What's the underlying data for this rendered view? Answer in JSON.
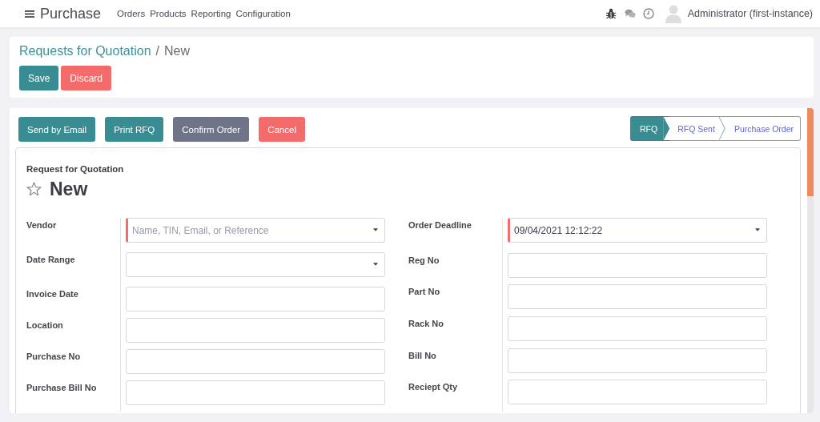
{
  "navbar": {
    "app_title": "Purchase",
    "menu": [
      "Orders",
      "Products",
      "Reporting",
      "Configuration"
    ],
    "user": "Administrator (first-instance)"
  },
  "control_panel": {
    "breadcrumb": [
      {
        "label": "Requests for Quotation",
        "kind": "link"
      },
      {
        "label": "New",
        "kind": "current"
      }
    ],
    "breadcrumb_separator": "/",
    "buttons": [
      {
        "label": "Save",
        "kind": "primary"
      },
      {
        "label": "Discard",
        "kind": "danger"
      }
    ]
  },
  "form": {
    "header_buttons": [
      {
        "label": "Send by Email",
        "kind": "primary"
      },
      {
        "label": "Print RFQ",
        "kind": "primary"
      },
      {
        "label": "Confirm Order",
        "kind": "secondary"
      },
      {
        "label": "Cancel",
        "kind": "danger"
      }
    ],
    "statusbar": [
      {
        "label": "RFQ",
        "selected": true
      },
      {
        "label": "RFQ Sent",
        "selected": false
      },
      {
        "label": "Purchase Order",
        "selected": false
      }
    ],
    "sheet": {
      "subtitle": "Request for Quotation",
      "title": "New",
      "starred": false
    },
    "left_fields": [
      {
        "label": "Vendor",
        "kind": "select",
        "required": true,
        "placeholder": "Name, TIN, Email, or Reference"
      },
      {
        "label": "Date Range",
        "kind": "select",
        "required": false
      },
      {
        "label": "Invoice Date",
        "kind": "text",
        "required": false
      },
      {
        "label": "Location",
        "kind": "text",
        "required": false
      },
      {
        "label": "Purchase No",
        "kind": "text",
        "required": false
      },
      {
        "label": "Purchase Bill No",
        "kind": "text",
        "required": false
      }
    ],
    "right_fields": [
      {
        "label": "Order Deadline",
        "kind": "select",
        "required": true,
        "value": "09/04/2021 12:12:22"
      },
      {
        "label": "Reg No",
        "kind": "text",
        "required": false
      },
      {
        "label": "Part No",
        "kind": "text",
        "required": false
      },
      {
        "label": "Rack No",
        "kind": "text",
        "required": false
      },
      {
        "label": "Bill No",
        "kind": "text",
        "required": false
      },
      {
        "label": "Reciept Qty",
        "kind": "text",
        "required": false
      }
    ]
  }
}
